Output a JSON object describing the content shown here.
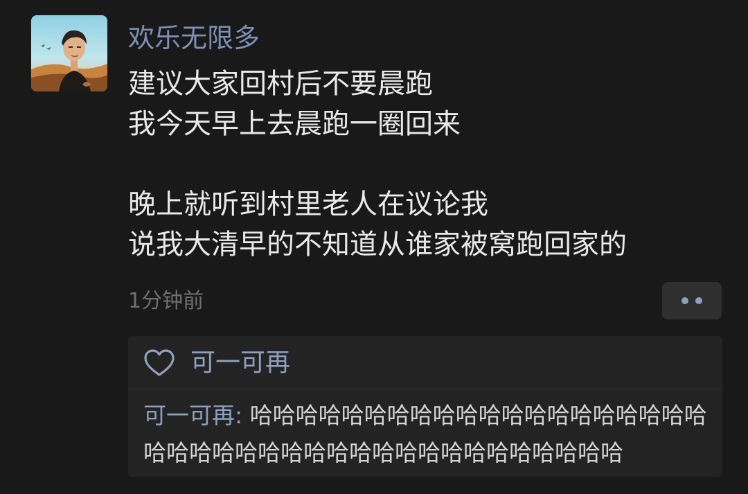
{
  "post": {
    "username": "欢乐无限多",
    "content_lines": [
      "建议大家回村后不要晨跑",
      "我今天早上去晨跑一圈回来",
      "",
      "晚上就听到村里老人在议论我",
      "说我大清早的不知道从谁家被窝跑回家的"
    ],
    "timestamp": "1分钟前",
    "more_icon": "more-dots-icon"
  },
  "likes": {
    "icon": "heart-icon",
    "names": "可一可再"
  },
  "comments": [
    {
      "author": "可一可再: ",
      "text_line1": "哈哈哈哈哈哈哈哈哈哈哈哈哈哈哈哈哈哈哈哈",
      "text_line2": "哈哈哈哈哈哈哈哈哈哈哈哈哈哈哈哈哈哈哈哈哈"
    }
  ],
  "colors": {
    "background": "#191919",
    "name_accent": "#7d90b3",
    "link_accent": "#8ea0c0",
    "panel": "#232323",
    "timestamp": "#6f6f6f"
  }
}
